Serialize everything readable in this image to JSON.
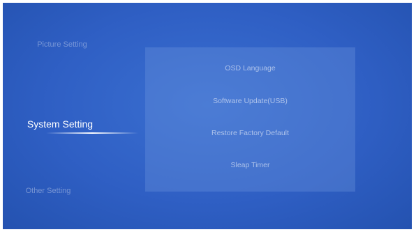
{
  "left_menu": {
    "items": [
      {
        "label": "Picture Setting",
        "state": "inactive"
      },
      {
        "label": "System Setting",
        "state": "active"
      },
      {
        "label": "Other Setting",
        "state": "inactive"
      }
    ]
  },
  "submenu": {
    "items": [
      {
        "label": "OSD Language"
      },
      {
        "label": "Software Update(USB)"
      },
      {
        "label": "Restore Factory Default"
      },
      {
        "label": "Sleap Timer"
      }
    ]
  },
  "colors": {
    "background": "#2f5fc4",
    "panel": "#6e96dc",
    "text_active": "#ffffff"
  }
}
